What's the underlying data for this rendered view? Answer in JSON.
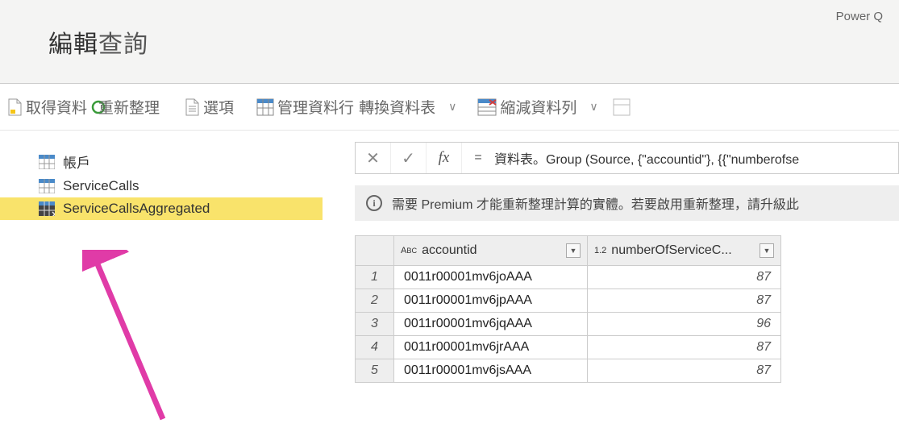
{
  "brand": "Power Q",
  "header": {
    "title_bold": "編輯",
    "title_light": "查詢"
  },
  "toolbar": {
    "get_data": "取得資料",
    "refresh": "重新整理",
    "options": "選項",
    "manage_columns": "管理資料行",
    "transform_table": "轉換資料表",
    "reduce_rows": "縮減資料列"
  },
  "sidebar": {
    "items": [
      {
        "label": "帳戶",
        "kind": "table"
      },
      {
        "label": "ServiceCalls",
        "kind": "table"
      },
      {
        "label": "ServiceCallsAggregated",
        "kind": "calc"
      }
    ]
  },
  "formula": {
    "eq": "=",
    "text": "資料表。Group (Source, {\"accountid\"}, {{\"numberofse"
  },
  "info": {
    "text": "需要 Premium 才能重新整理計算的實體。若要啟用重新整理，請升級此"
  },
  "table": {
    "columns": [
      {
        "type": "ABC",
        "label": "accountid"
      },
      {
        "type": "1.2",
        "label": "numberOfServiceC..."
      }
    ],
    "rows": [
      {
        "n": "1",
        "accountid": "0011r00001mv6joAAA",
        "num": "87"
      },
      {
        "n": "2",
        "accountid": "0011r00001mv6jpAAA",
        "num": "87"
      },
      {
        "n": "3",
        "accountid": "0011r00001mv6jqAAA",
        "num": "96"
      },
      {
        "n": "4",
        "accountid": "0011r00001mv6jrAAA",
        "num": "87"
      },
      {
        "n": "5",
        "accountid": "0011r00001mv6jsAAA",
        "num": "87"
      }
    ]
  }
}
